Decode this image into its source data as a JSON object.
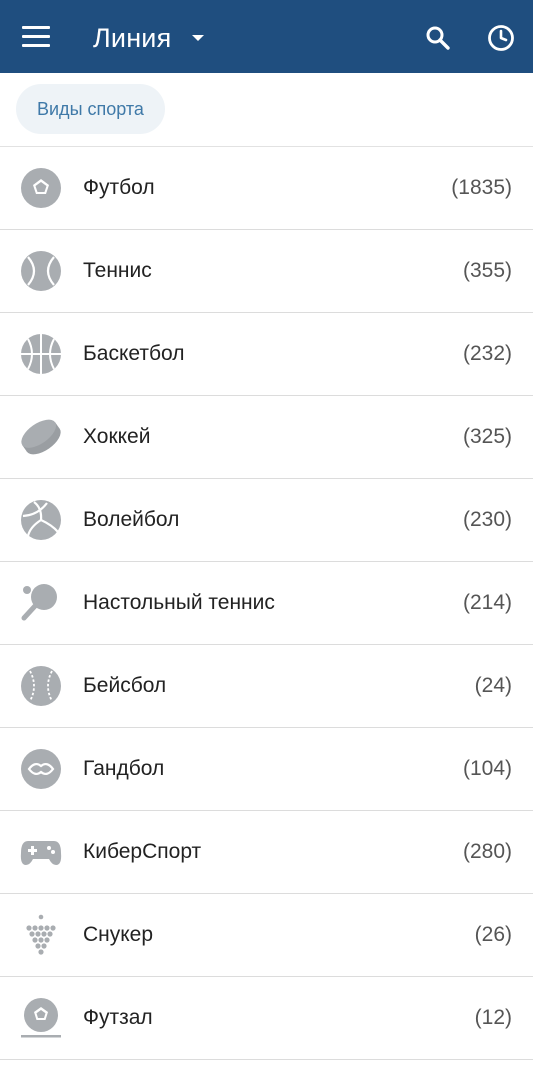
{
  "header": {
    "title": "Линия",
    "menu_icon": "menu-icon",
    "search_icon": "search-icon",
    "history_icon": "clock-icon",
    "background_color": "#1f4e7f"
  },
  "filter": {
    "chip_label": "Виды спорта"
  },
  "sports": [
    {
      "name": "Футбол",
      "count": "(1835)",
      "icon": "football-icon"
    },
    {
      "name": "Теннис",
      "count": "(355)",
      "icon": "tennis-ball-icon"
    },
    {
      "name": "Баскетбол",
      "count": "(232)",
      "icon": "basketball-icon"
    },
    {
      "name": "Хоккей",
      "count": "(325)",
      "icon": "hockey-puck-icon"
    },
    {
      "name": "Волейбол",
      "count": "(230)",
      "icon": "volleyball-icon"
    },
    {
      "name": "Настольный теннис",
      "count": "(214)",
      "icon": "ping-pong-icon"
    },
    {
      "name": "Бейсбол",
      "count": "(24)",
      "icon": "baseball-icon"
    },
    {
      "name": "Гандбол",
      "count": "(104)",
      "icon": "handball-icon"
    },
    {
      "name": "КиберСпорт",
      "count": "(280)",
      "icon": "gamepad-icon"
    },
    {
      "name": "Снукер",
      "count": "(26)",
      "icon": "snooker-icon"
    },
    {
      "name": "Футзал",
      "count": "(12)",
      "icon": "futsal-icon"
    }
  ]
}
